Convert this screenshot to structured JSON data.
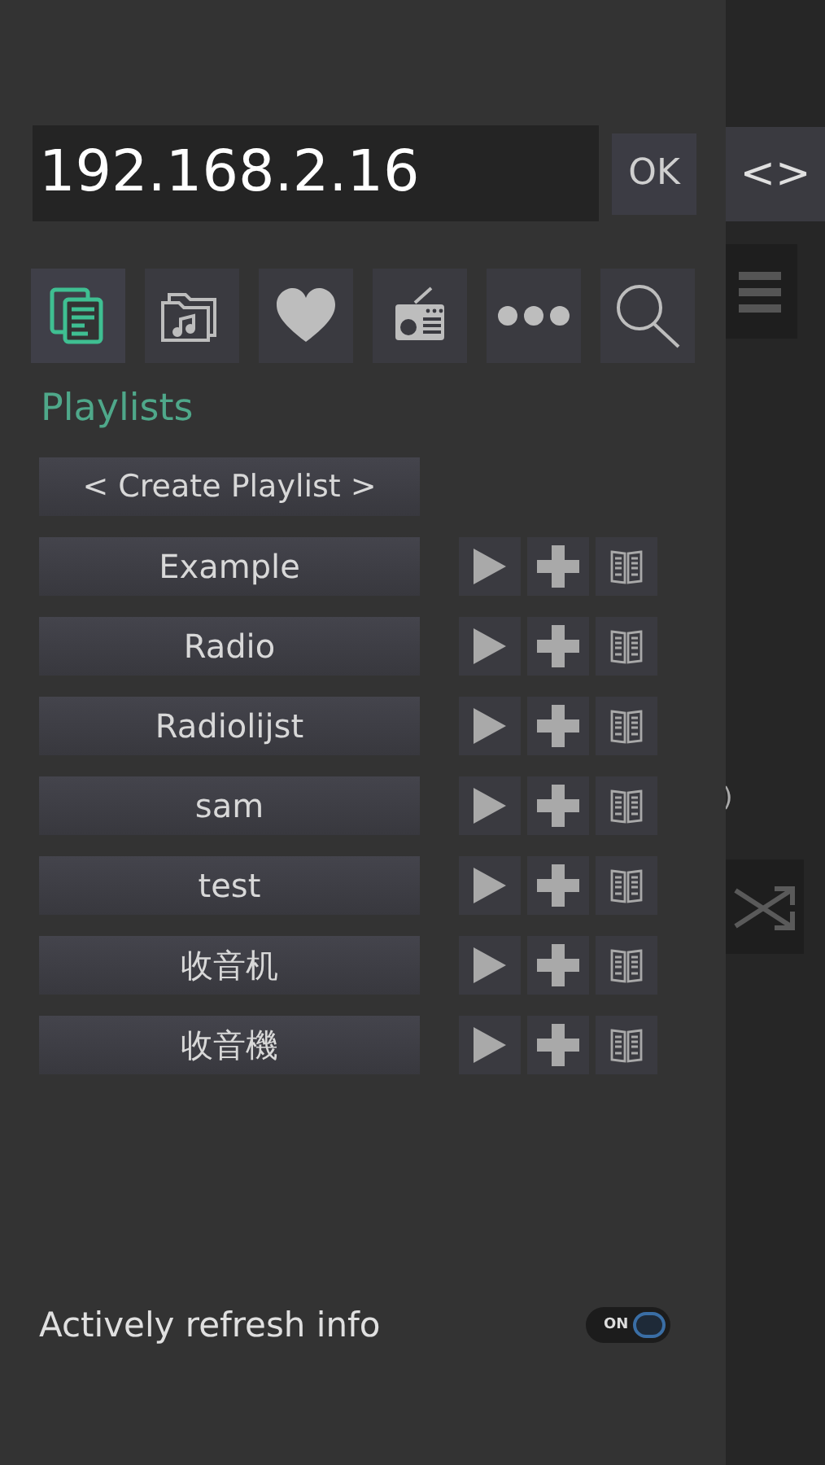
{
  "drawer": {
    "address": {
      "value": "192.168.2.16"
    },
    "ok_button": "OK",
    "nav_icons": [
      {
        "kind": "playlists",
        "selected": true
      },
      {
        "kind": "folder",
        "selected": false
      },
      {
        "kind": "favorites",
        "selected": false
      },
      {
        "kind": "radio",
        "selected": false
      },
      {
        "kind": "more",
        "selected": false
      },
      {
        "kind": "search",
        "selected": false
      }
    ],
    "section_title": "Playlists",
    "create_button": "< Create Playlist >",
    "playlists": [
      {
        "name": "Example"
      },
      {
        "name": "Radio"
      },
      {
        "name": "Radiolijst"
      },
      {
        "name": "sam"
      },
      {
        "name": "test"
      },
      {
        "name": "收音机"
      },
      {
        "name": "收音機"
      }
    ],
    "refresh": {
      "label": "Actively refresh info",
      "toggle": {
        "on": true,
        "label": "ON"
      }
    }
  },
  "background": {
    "toggle_button": "<>",
    "text_fragment": ")"
  }
}
